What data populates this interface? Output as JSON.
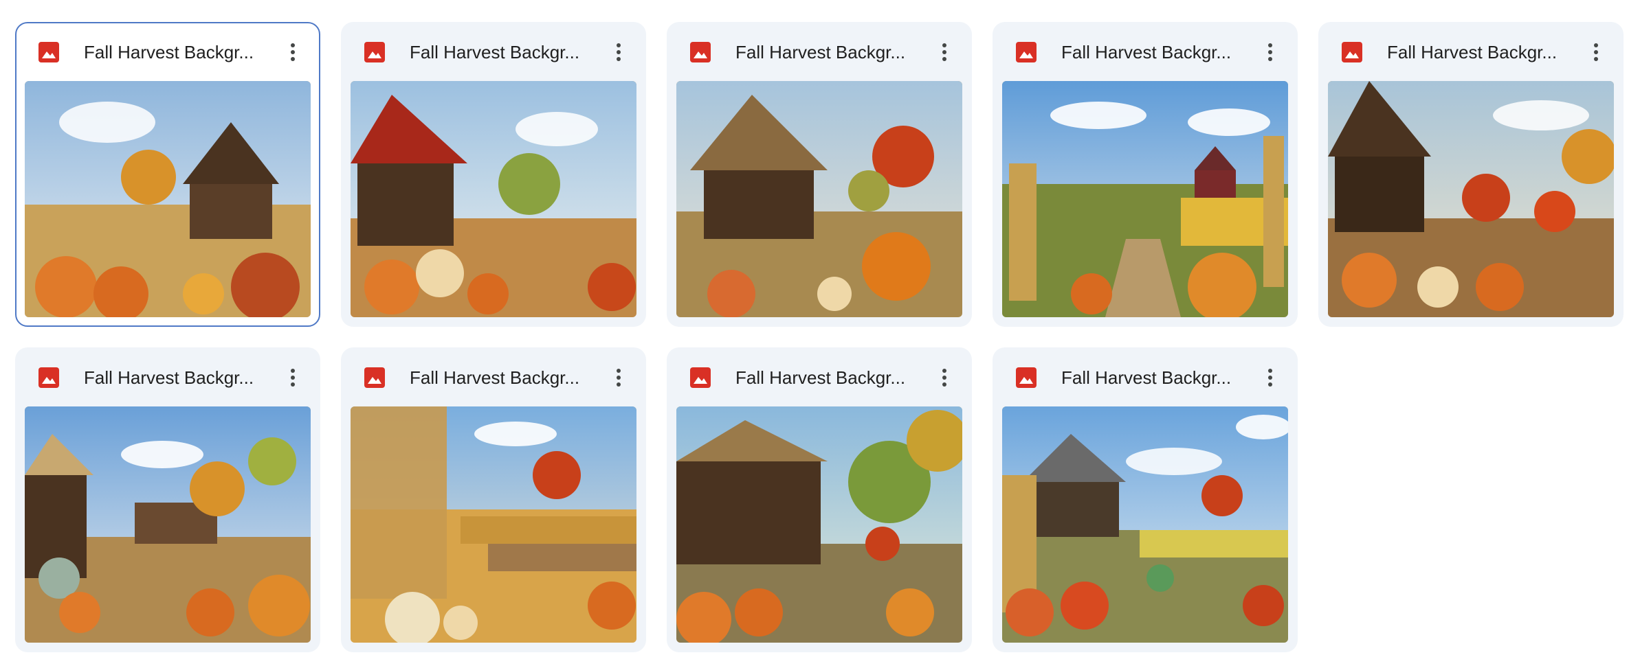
{
  "files": [
    {
      "name": "Fall Harvest Backgr...",
      "selected": true
    },
    {
      "name": "Fall Harvest Backgr...",
      "selected": false
    },
    {
      "name": "Fall Harvest Backgr...",
      "selected": false
    },
    {
      "name": "Fall Harvest Backgr...",
      "selected": false
    },
    {
      "name": "Fall Harvest Backgr...",
      "selected": false
    },
    {
      "name": "Fall Harvest Backgr...",
      "selected": false
    },
    {
      "name": "Fall Harvest Backgr...",
      "selected": false
    },
    {
      "name": "Fall Harvest Backgr...",
      "selected": false
    },
    {
      "name": "Fall Harvest Backgr...",
      "selected": false
    }
  ],
  "icons": {
    "file_type": "image-file-icon",
    "more": "more-vert-icon"
  },
  "colors": {
    "image_icon": "#d93025",
    "card_bg": "#f0f4f9",
    "selected_border": "#4f79c6",
    "title_text": "#1f1f1f",
    "more_icon": "#444746"
  }
}
